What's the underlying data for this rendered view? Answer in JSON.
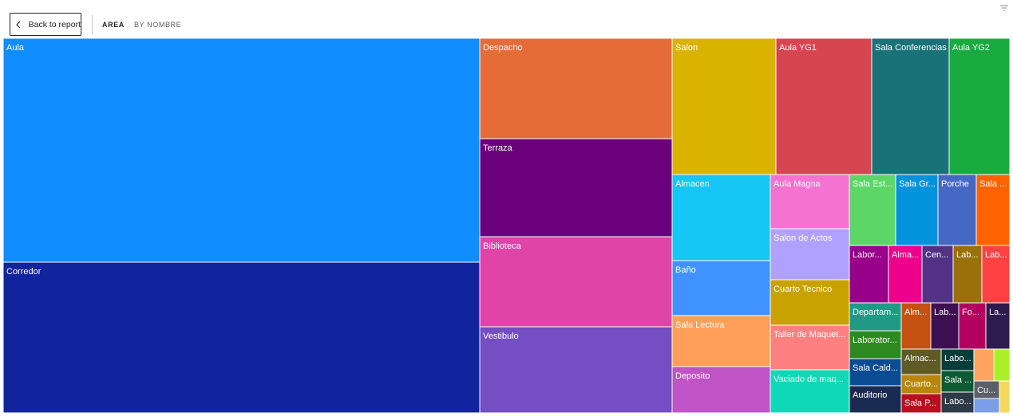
{
  "toolbar": {
    "back_label": "Back to report",
    "drill_levels": [
      "AREA",
      "BY NOMBRE"
    ],
    "filter_icon": "filter-icon",
    "back_icon": "chevron-left-icon"
  },
  "chart_data": {
    "type": "treemap",
    "title": "",
    "items": [
      {
        "label": "Aula",
        "color": "#118DFF"
      },
      {
        "label": "Corredor",
        "color": "#12239E"
      },
      {
        "label": "Despacho",
        "color": "#E66C37"
      },
      {
        "label": "Terraza",
        "color": "#6B007B"
      },
      {
        "label": "Biblioteca",
        "color": "#E044A7"
      },
      {
        "label": "Vestibulo",
        "color": "#744EC2"
      },
      {
        "label": "Salon",
        "color": "#D9B300"
      },
      {
        "label": "Aula YG1",
        "color": "#D64550"
      },
      {
        "label": "Sala Conferencias",
        "color": "#197278"
      },
      {
        "label": "Aula YG2",
        "color": "#1AAB40"
      },
      {
        "label": "Almacen",
        "color": "#15C6F4"
      },
      {
        "label": "Aula Magna",
        "color": "#F472D0"
      },
      {
        "label": "Baño",
        "color": "#4092FF"
      },
      {
        "label": "Salon de Actos",
        "color": "#B1A1FF"
      },
      {
        "label": "Cuarto Tecnico",
        "color": "#C7A200"
      },
      {
        "label": "Sala Lectura",
        "color": "#FF9F5A"
      },
      {
        "label": "Taller de Maquet...",
        "color": "#FF8080"
      },
      {
        "label": "Deposito",
        "color": "#C053C6"
      },
      {
        "label": "Vaciado de maq...",
        "color": "#0FD8B7"
      },
      {
        "label": "Sala Est...",
        "color": "#5BD667"
      },
      {
        "label": "Sala Gr...",
        "color": "#0393DC"
      },
      {
        "label": "Porche",
        "color": "#4668C5"
      },
      {
        "label": "Sala ...",
        "color": "#FF6300"
      },
      {
        "label": "Labor...",
        "color": "#99008A"
      },
      {
        "label": "Alma...",
        "color": "#EC008C"
      },
      {
        "label": "Cen...",
        "color": "#533285"
      },
      {
        "label": "Lab...",
        "color": "#99700A"
      },
      {
        "label": "Lab...",
        "color": "#FF4141"
      },
      {
        "label": "Departam...",
        "color": "#1F9A85"
      },
      {
        "label": "Alm...",
        "color": "#C4510F"
      },
      {
        "label": "Lab...",
        "color": "#3E1052"
      },
      {
        "label": "Fo...",
        "color": "#B3005F"
      },
      {
        "label": "La...",
        "color": "#2E1A4F"
      },
      {
        "label": "Laborator...",
        "color": "#2D8A20"
      },
      {
        "label": "Almac...",
        "color": "#5E5B26"
      },
      {
        "label": "Labo...",
        "color": "#053D3B"
      },
      {
        "label": "",
        "color": "#FFA460"
      },
      {
        "label": "",
        "color": "#A9F126"
      },
      {
        "label": "Sala Cald...",
        "color": "#0A4C93"
      },
      {
        "label": "Cuarto...",
        "color": "#B8860B"
      },
      {
        "label": "Sala ...",
        "color": "#0E5A33"
      },
      {
        "label": "Cu...",
        "color": "#5C5E6A"
      },
      {
        "label": "",
        "color": "#7C9DEA"
      },
      {
        "label": "",
        "color": "#F5D75E"
      },
      {
        "label": "Auditorio",
        "color": "#1A2B52"
      },
      {
        "label": "Sala P...",
        "color": "#B80F1F"
      },
      {
        "label": "Labo...",
        "color": "#2E3A48"
      }
    ]
  }
}
